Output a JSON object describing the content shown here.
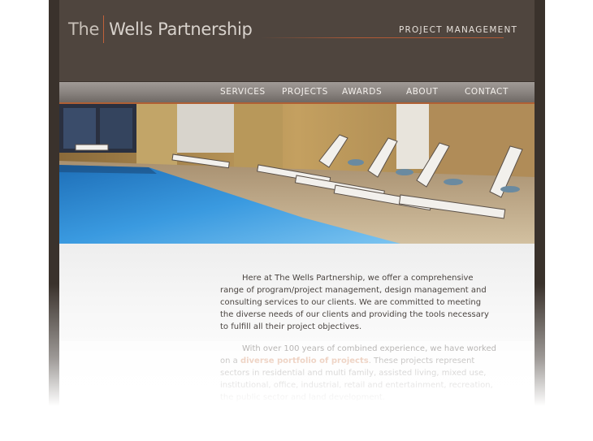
{
  "brand": {
    "logo_the": "The",
    "logo_name": "Wells Partnership",
    "tagline": "PROJECT MANAGEMENT"
  },
  "nav": {
    "items": [
      {
        "label": "SERVICES"
      },
      {
        "label": "PROJECTS"
      },
      {
        "label": "AWARDS"
      },
      {
        "label": "ABOUT"
      },
      {
        "label": "CONTACT"
      }
    ]
  },
  "colors": {
    "header_bg": "#4f453e",
    "frame_bg": "#3a322c",
    "accent": "#c0613a",
    "link": "#c9703f"
  },
  "content": {
    "paragraph1": "Here at The Wells Partnership, we offer a comprehensive range of program/project management, design management and consulting services to our clients.  We are committed to meeting the diverse needs of our clients and providing the tools necessary to fulfill all their project objectives.",
    "paragraph2_before": "With over 100 years of combined experience, we have worked on a ",
    "paragraph2_link": "diverse portfolio of projects",
    "paragraph2_after": ".  These projects represent sectors in residential and multi family, assisted living, mixed use, institutional, office, industrial, retail and entertainment, recreation, the public sector and land development."
  }
}
